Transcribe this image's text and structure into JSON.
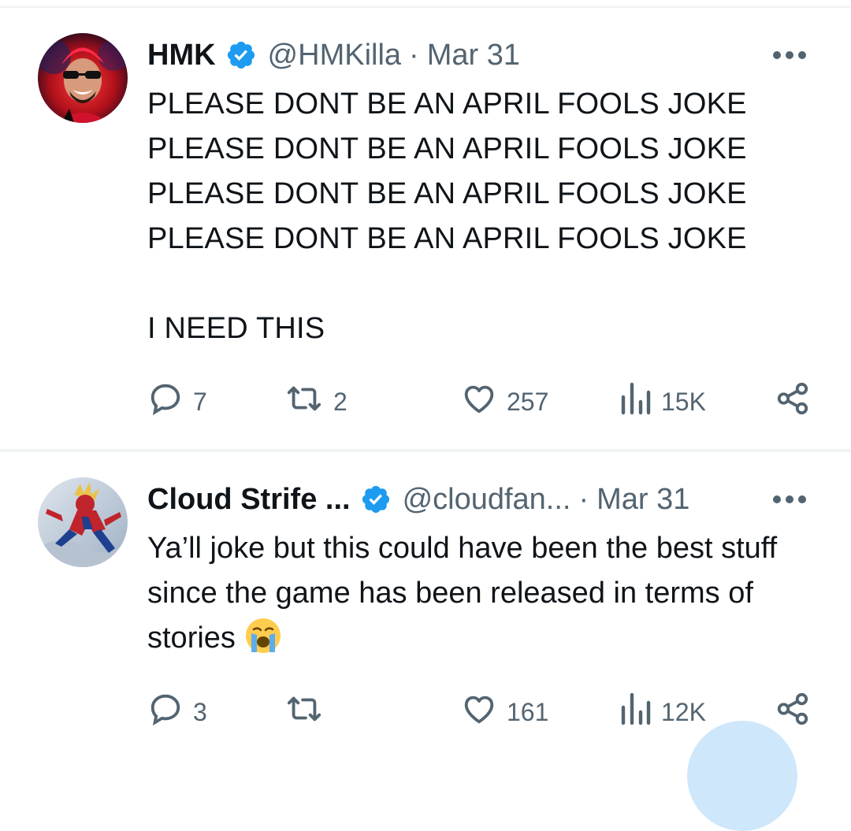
{
  "tweets": [
    {
      "display_name": "HMK",
      "verified": true,
      "handle": "@HMKilla",
      "separator": "·",
      "date": "Mar 31",
      "body": "PLEASE DONT BE AN APRIL FOOLS JOKE\nPLEASE DONT BE AN APRIL FOOLS JOKE\nPLEASE DONT BE AN APRIL FOOLS JOKE\nPLEASE DONT BE AN APRIL FOOLS JOKE\n\nI NEED THIS",
      "stats": {
        "replies": "7",
        "retweets": "2",
        "likes": "257",
        "views": "15K"
      }
    },
    {
      "display_name": "Cloud Strife ...",
      "verified": true,
      "handle": "@cloudfan...",
      "separator": "·",
      "date": "Mar 31",
      "body": "Ya’ll joke but this could have been the best stuff since the game has been released in terms of stories",
      "body_emoji": "loudly-crying-face-emoji",
      "stats": {
        "replies": "3",
        "retweets": "",
        "likes": "161",
        "views": "12K"
      }
    }
  ],
  "colors": {
    "text_primary": "#0f1419",
    "text_secondary": "#536471",
    "verified_blue": "#1d9bf0",
    "divider": "#eff3f4",
    "fab": "#cfe7fb"
  },
  "icons": {
    "verified": "verified-badge-icon",
    "more": "more-dots-icon",
    "reply": "reply-bubble-icon",
    "retweet": "retweet-icon",
    "like": "heart-icon",
    "views": "views-bars-icon",
    "share": "share-icon"
  }
}
